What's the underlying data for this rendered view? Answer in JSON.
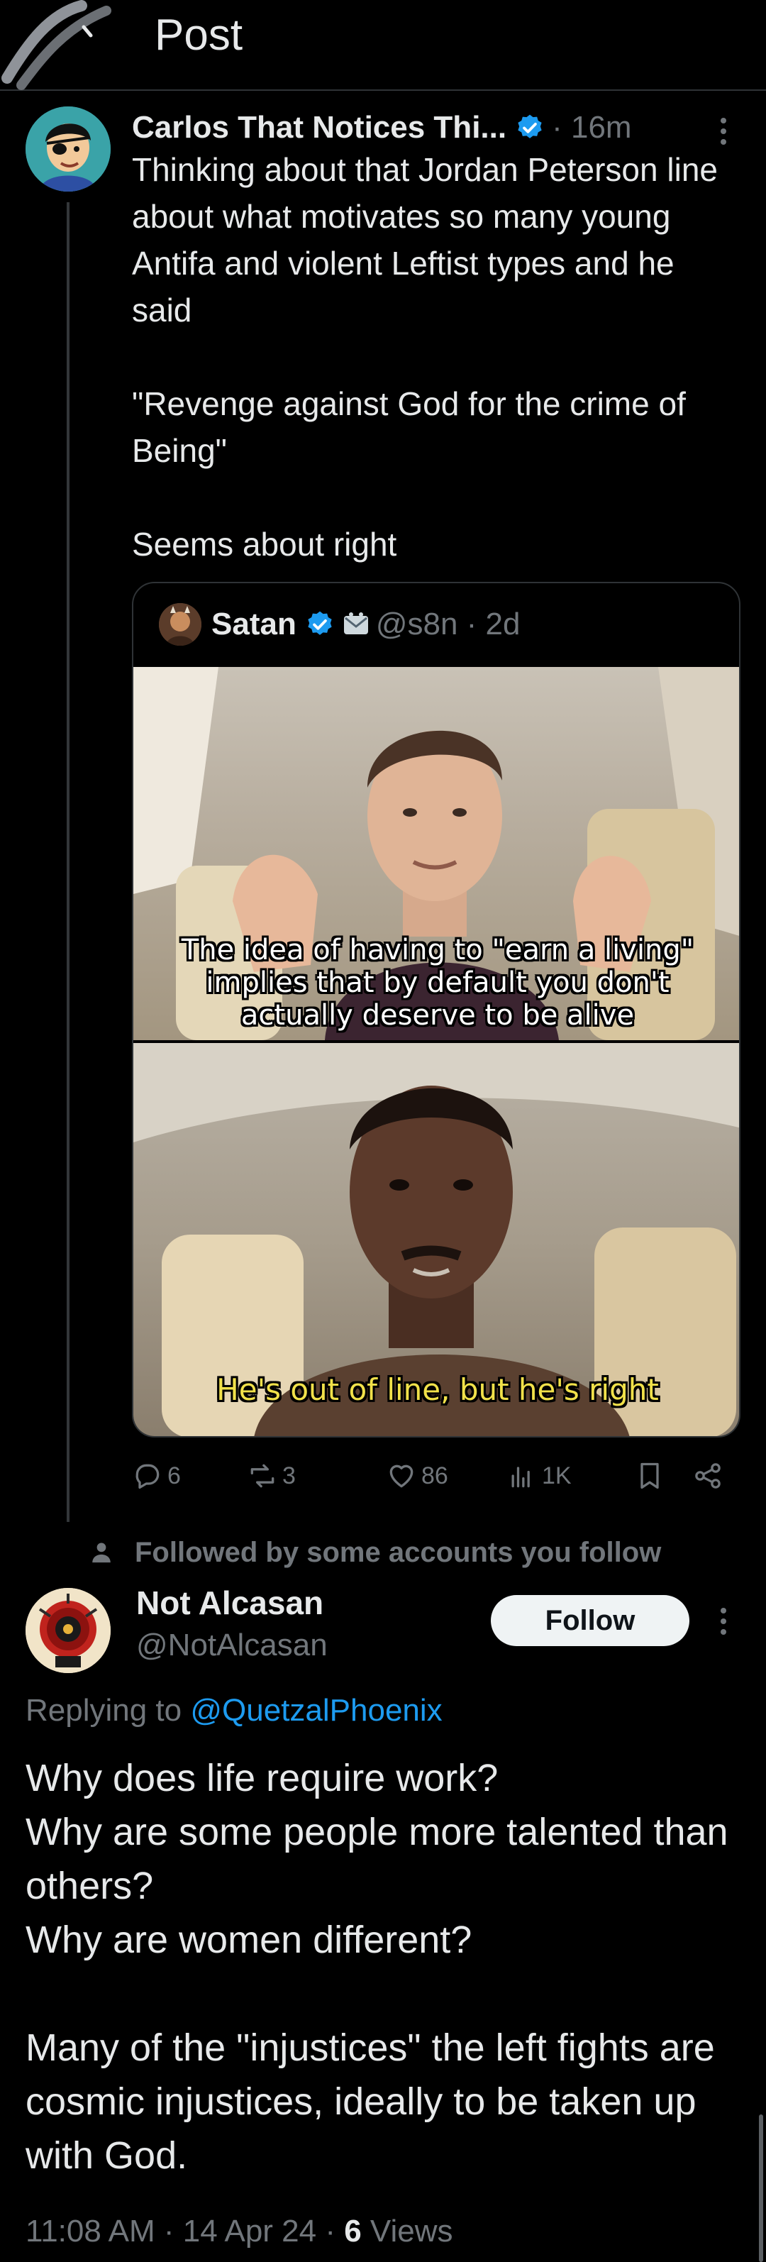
{
  "header": {
    "title": "Post"
  },
  "main_post": {
    "author_name": "Carlos That Notices Thi...",
    "time": "· 16m",
    "text": "Thinking about that Jordan Peterson line about what motivates so many young Antifa and violent Leftist types and he said\n\n\"Revenge against God for the crime of Being\"\n\nSeems about right",
    "quote": {
      "name": "Satan",
      "handle": "@s8n · 2d",
      "caption_top": "The idea of having to \"earn a living\"\nimplies that by default you don't\nactually deserve to be alive",
      "caption_bottom": "He's out of line, but he's right"
    },
    "actions": {
      "replies": "6",
      "reposts": "3",
      "likes": "86",
      "views": "1K"
    }
  },
  "social_context": "Followed by some accounts you follow",
  "reply": {
    "name": "Not Alcasan",
    "handle": "@NotAlcasan",
    "follow_label": "Follow",
    "replying_prefix": "Replying to ",
    "replying_to": "@QuetzalPhoenix",
    "text": "Why does life require work?\nWhy are some people more talented than others?\nWhy are women different?\n\nMany of the \"injustices\" the left fights are cosmic injustices, ideally to be taken up with God.",
    "meta_time": "11:08 AM · 14 Apr 24 · ",
    "meta_views_count": "6",
    "meta_views_label": " Views"
  },
  "colors": {
    "background": "#000000",
    "text": "#e7e9ea",
    "muted": "#71767b",
    "link": "#1d9bf0",
    "verified": "#1d9bf0"
  },
  "icons": [
    "back-scribble",
    "verified-icon",
    "more-icon",
    "mail-icon",
    "reply-icon",
    "repost-icon",
    "like-icon",
    "views-icon",
    "bookmark-icon",
    "share-icon",
    "person-icon"
  ]
}
